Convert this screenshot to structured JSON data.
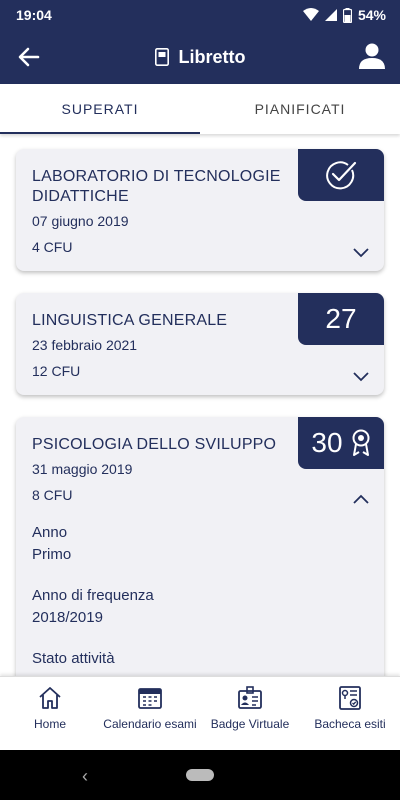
{
  "status_bar": {
    "time": "19:04",
    "battery": "54%"
  },
  "header": {
    "title": "Libretto"
  },
  "tabs": [
    {
      "label": "SUPERATI",
      "active": true
    },
    {
      "label": "PIANIFICATI",
      "active": false
    }
  ],
  "exams": [
    {
      "name": "LABORATORIO DI TECNOLOGIE DIDATTICHE",
      "date": "07 giugno 2019",
      "cfu": "4 CFU",
      "grade": "",
      "badge_icon": "check-circle-icon",
      "expanded": false
    },
    {
      "name": "LINGUISTICA GENERALE",
      "date": "23 febbraio 2021",
      "cfu": "12 CFU",
      "grade": "27",
      "badge_icon": "",
      "expanded": false
    },
    {
      "name": "PSICOLOGIA DELLO SVILUPPO",
      "date": "31 maggio 2019",
      "cfu": "8 CFU",
      "grade": "30",
      "badge_icon": "ribbon-award-icon",
      "expanded": true,
      "details": [
        {
          "label": "Anno",
          "value": "Primo"
        },
        {
          "label": "Anno di frequenza",
          "value": "2018/2019"
        },
        {
          "label": "Stato attività",
          "value": ""
        }
      ]
    }
  ],
  "bottom_nav": [
    {
      "label": "Home",
      "icon": "home-icon"
    },
    {
      "label": "Calendario esami",
      "icon": "calendar-icon"
    },
    {
      "label": "Badge Virtuale",
      "icon": "badge-id-icon"
    },
    {
      "label": "Bacheca esiti",
      "icon": "results-board-icon"
    }
  ],
  "colors": {
    "primary": "#232f5c",
    "card_bg": "#f1f1f5"
  }
}
